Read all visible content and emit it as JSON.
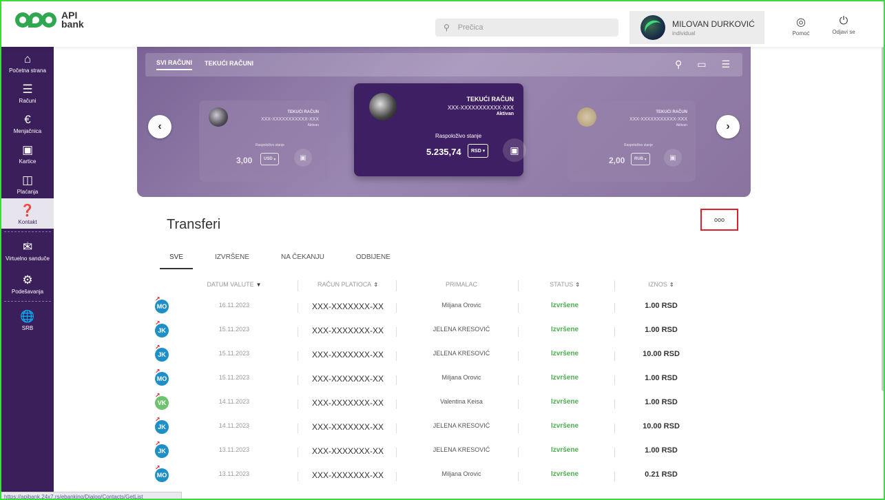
{
  "app": {
    "logo_text_line1": "API",
    "logo_text_line2": "bank"
  },
  "search": {
    "placeholder": "Prečica"
  },
  "user": {
    "name": "MILOVAN DURKOVIĆ",
    "type": "individual"
  },
  "top_actions": {
    "help": "Pomoć",
    "logout": "Odjavi se"
  },
  "sidebar": {
    "items": [
      {
        "label": "Početna strana",
        "icon": "home-icon"
      },
      {
        "label": "Računi",
        "icon": "list-icon"
      },
      {
        "label": "Menjačnica",
        "icon": "exchange-icon"
      },
      {
        "label": "Kartice",
        "icon": "card-icon"
      },
      {
        "label": "Plaćanja",
        "icon": "wallet-icon"
      },
      {
        "label": "Kontakt",
        "icon": "support-icon"
      },
      {
        "label": "Virtuelno sanduče",
        "icon": "mail-icon"
      },
      {
        "label": "Podešavanja",
        "icon": "gear-icon"
      },
      {
        "label": "SRB",
        "icon": "globe-icon"
      }
    ]
  },
  "hero": {
    "tabs": [
      "SVI RAČUNI",
      "TEKUĆI RAČUNI"
    ],
    "cards": [
      {
        "type": "TEKUĆI RAČUN",
        "number": "XXX-XXXXXXXXXXX-XXX",
        "status": "Aktivan",
        "balance_label": "Raspoloživo stanje",
        "balance": "3,00",
        "currency": "USD"
      },
      {
        "type": "TEKUĆI RAČUN",
        "number": "XXX-XXXXXXXXXXX-XXX",
        "status": "Aktivan",
        "balance_label": "Raspoloživo stanje",
        "balance": "5.235,74",
        "currency": "RSD"
      },
      {
        "type": "TEKUĆI RAČUN",
        "number": "XXX-XXXXXXXXXXX-XXX",
        "status": "Aktivan",
        "balance_label": "Raspoloživo stanje",
        "balance": "2,00",
        "currency": "RUB"
      }
    ]
  },
  "transfers": {
    "title": "Transferi",
    "more": "ooo",
    "tabs": [
      "SVE",
      "IZVRŠENE",
      "NA ČEKANJU",
      "ODBIJENE"
    ],
    "columns": [
      "DATUM VALUTE",
      "RAČUN PLATIOCA",
      "PRIMALAC",
      "STATUS",
      "IZNOS"
    ],
    "rows": [
      {
        "initials": "MO",
        "color": "#1f8fc8",
        "date": "16.11.2023",
        "account": "XXX-XXXXXXX-XX",
        "recipient": "Miljana Orovic",
        "status": "Izvršene",
        "amount": "1.00 RSD"
      },
      {
        "initials": "JK",
        "color": "#1f8fc8",
        "date": "15.11.2023",
        "account": "XXX-XXXXXXX-XX",
        "recipient": "JELENA KRESOVIĆ",
        "status": "Izvršene",
        "amount": "1.00 RSD"
      },
      {
        "initials": "JK",
        "color": "#1f8fc8",
        "date": "15.11.2023",
        "account": "XXX-XXXXXXX-XX",
        "recipient": "JELENA KRESOVIĆ",
        "status": "Izvršene",
        "amount": "10.00 RSD"
      },
      {
        "initials": "MO",
        "color": "#1f8fc8",
        "date": "15.11.2023",
        "account": "XXX-XXXXXXX-XX",
        "recipient": "Miljana Orovic",
        "status": "Izvršene",
        "amount": "1.00 RSD"
      },
      {
        "initials": "VK",
        "color": "#6ec46e",
        "date": "14.11.2023",
        "account": "XXX-XXXXXXX-XX",
        "recipient": "Valentina Keisa",
        "status": "Izvršene",
        "amount": "1.00 RSD"
      },
      {
        "initials": "JK",
        "color": "#1f8fc8",
        "date": "14.11.2023",
        "account": "XXX-XXXXXXX-XX",
        "recipient": "JELENA KRESOVIĆ",
        "status": "Izvršene",
        "amount": "10.00 RSD"
      },
      {
        "initials": "JK",
        "color": "#1f8fc8",
        "date": "13.11.2023",
        "account": "XXX-XXXXXXX-XX",
        "recipient": "JELENA KRESOVIĆ",
        "status": "Izvršene",
        "amount": "1.00 RSD"
      },
      {
        "initials": "MO",
        "color": "#1f8fc8",
        "date": "13.11.2023",
        "account": "XXX-XXXXXXX-XX",
        "recipient": "Miljana Orovic",
        "status": "Izvršene",
        "amount": "0.21 RSD"
      }
    ]
  },
  "statusbar": {
    "url": "https://apibank.24x7.rs/ebanking/Dialog/Contacts/GetList"
  },
  "colors": {
    "sidebar": "#3b1f5b",
    "status_ok": "#4caf50",
    "highlight": "#e01f2d",
    "frame": "#3ddc3d"
  }
}
